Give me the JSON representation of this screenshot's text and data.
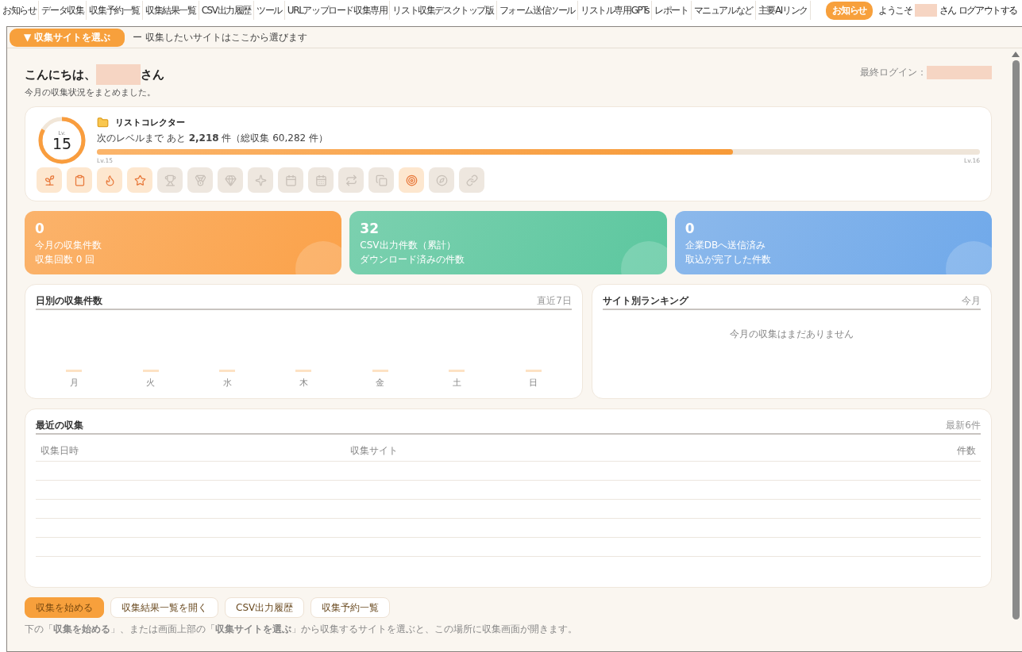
{
  "nav": {
    "items": [
      {
        "label": "お知らせ"
      },
      {
        "label": "データ収集"
      },
      {
        "label": "収集予約一覧"
      },
      {
        "label": "収集結果一覧"
      },
      {
        "label": "CSV出力履歴"
      },
      {
        "label": "ツール"
      },
      {
        "label": "URLアップロード収集専用"
      },
      {
        "label": "リスト収集デスクトップ版"
      },
      {
        "label": "フォーム送信ツール"
      },
      {
        "label": "リストル専用GPTs"
      },
      {
        "label": "レポート"
      },
      {
        "label": "マニュアルなど"
      },
      {
        "label": "主要AIリンク"
      }
    ],
    "notice_button": "お知らせ",
    "welcome": "ようこそ",
    "honorific": "さん",
    "logout": "ログアウトする"
  },
  "site_bar": {
    "button": "▼ 収集サイトを選ぶ",
    "hint": "ー 収集したいサイトはここから選びます"
  },
  "greeting": {
    "prefix": "こんにちは、",
    "suffix": "さん",
    "subtitle": "今月の収集状況をまとめました。",
    "last_login": "最終ログイン："
  },
  "level_card": {
    "lv_label": "Lv.",
    "level": "15",
    "ring": {
      "level": 0.83
    },
    "title": "リストコレクター",
    "progress_text": "次のレベルまで あと **2,218** 件（総収集 60,282 件）",
    "progress": {
      "level": 0.72
    },
    "current": "Lv.15",
    "next": "Lv.16",
    "badges": [
      {
        "kind": "sprout",
        "earned": true
      },
      {
        "kind": "clipboard",
        "earned": true
      },
      {
        "kind": "flame",
        "earned": true
      },
      {
        "kind": "star",
        "earned": true
      },
      {
        "kind": "trophy",
        "earned": false
      },
      {
        "kind": "medal",
        "earned": false
      },
      {
        "kind": "gem",
        "earned": false
      },
      {
        "kind": "sparkle",
        "earned": false
      },
      {
        "kind": "calendar",
        "earned": false
      },
      {
        "kind": "calendar-days",
        "earned": false
      },
      {
        "kind": "repeat",
        "earned": false
      },
      {
        "kind": "copy",
        "earned": false
      },
      {
        "kind": "target",
        "earned": true
      },
      {
        "kind": "compass",
        "earned": false
      },
      {
        "kind": "link",
        "earned": false
      }
    ]
  },
  "stats": [
    {
      "value": "0",
      "label": "今月の収集件数",
      "sub": "収集回数 0 回",
      "color": "#fba24a"
    },
    {
      "value": "32",
      "label": "CSV出力件数（累計）",
      "sub": "ダウンロード済みの件数",
      "color": "#5cc79f"
    },
    {
      "value": "0",
      "label": "企業DBへ送信済み",
      "sub": "取込が完了した件数",
      "color": "#70a9ea"
    }
  ],
  "daily": {
    "title": "日別の収集件数",
    "range": "直近7日",
    "days": [
      "月",
      "火",
      "水",
      "木",
      "金",
      "土",
      "日"
    ]
  },
  "ranking": {
    "title": "サイト別ランキング",
    "range": "今月",
    "empty": "今月の収集はまだありません"
  },
  "recent": {
    "title": "最近の収集",
    "range": "最新6件",
    "columns": [
      "収集日時",
      "収集サイト",
      "件数"
    ]
  },
  "actions": [
    {
      "label": "収集を始める",
      "primary": true
    },
    {
      "label": "収集結果一覧を開く",
      "primary": false
    },
    {
      "label": "CSV出力履歴",
      "primary": false
    },
    {
      "label": "収集予約一覧",
      "primary": false
    }
  ],
  "footnote": "下の「**収集を始める**」、または画面上部の「**収集サイトを選ぶ**」から収集するサイトを選ぶと、この場所に収集画面が開きます。"
}
